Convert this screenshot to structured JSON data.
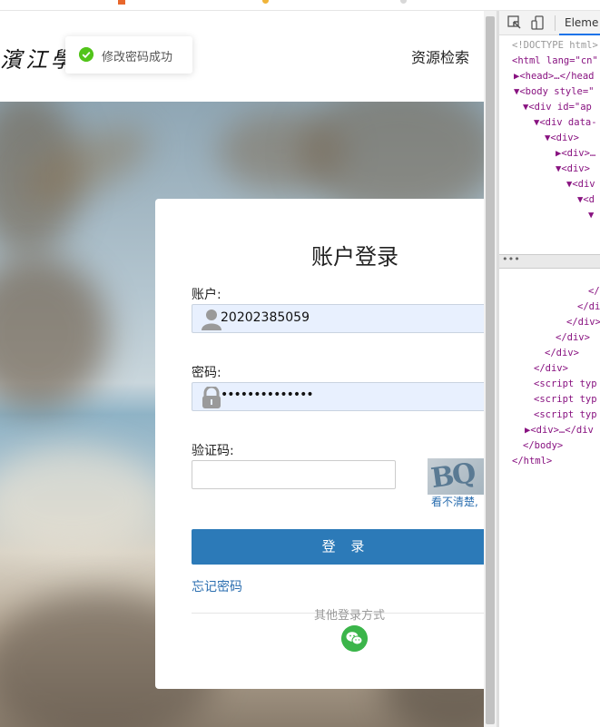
{
  "browser": {
    "name": "browser-top-strip"
  },
  "header": {
    "logo_text": "濱江學",
    "nav_search": "资源检索"
  },
  "toast": {
    "message": "修改密码成功",
    "icon": "check-circle-icon",
    "color": "#52c41a"
  },
  "login": {
    "title": "账户登录",
    "account_label": "账户:",
    "account_value": "20202385059",
    "password_label": "密码:",
    "password_value": "••••••••••••••",
    "captcha_label": "验证码:",
    "captcha_value": "",
    "captcha_text": "BQ",
    "captcha_tip": "看不清楚,",
    "login_button": "登 录",
    "forgot": "忘记密码",
    "other_methods": "其他登录方式",
    "accent_color": "#2c7ab8"
  },
  "devtools": {
    "tab": "Eleme",
    "lines_top": [
      {
        "text": "<!DOCTYPE html>",
        "cls": "g"
      },
      {
        "text": "<html lang=\"cn\"",
        "cls": "t"
      },
      {
        "text": "▶<head>…</head",
        "cls": "t"
      },
      {
        "text": "▼<body style=\"",
        "cls": "t"
      },
      {
        "text": "▼<div id=\"ap",
        "cls": "t"
      },
      {
        "text": "▼<div data-",
        "cls": "t"
      },
      {
        "text": "▼<div>",
        "cls": "t"
      },
      {
        "text": "▶<div>…",
        "cls": "t"
      },
      {
        "text": "▼<div>",
        "cls": "t"
      },
      {
        "text": "▼<div",
        "cls": "t"
      },
      {
        "text": "▼<d",
        "cls": "t"
      },
      {
        "text": "▼",
        "cls": "t"
      }
    ],
    "lines_bottom": [
      {
        "text": "</",
        "cls": "t"
      },
      {
        "text": "</di",
        "cls": "t"
      },
      {
        "text": "</div>",
        "cls": "t"
      },
      {
        "text": "</div>",
        "cls": "t"
      },
      {
        "text": "</div>",
        "cls": "t"
      },
      {
        "text": "</div>",
        "cls": "t"
      },
      {
        "text": "<script typ",
        "cls": "t"
      },
      {
        "text": "<script typ",
        "cls": "t"
      },
      {
        "text": "<script typ",
        "cls": "t"
      },
      {
        "text": "▶<div>…</div",
        "cls": "t"
      },
      {
        "text": "</body>",
        "cls": "t"
      },
      {
        "text": "</html>",
        "cls": "t"
      }
    ],
    "separator": "•••"
  }
}
